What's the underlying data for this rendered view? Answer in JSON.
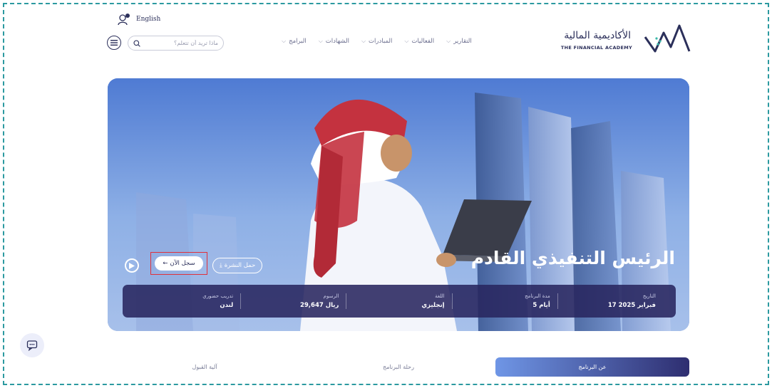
{
  "header": {
    "language_label": "English",
    "search": {
      "placeholder": "ماذا تريد أن تتعلم؟"
    },
    "nav": [
      {
        "label": "البرامج"
      },
      {
        "label": "الشهادات"
      },
      {
        "label": "المبادرات"
      },
      {
        "label": "الفعاليات"
      },
      {
        "label": "التقارير"
      }
    ],
    "logo": {
      "arabic": "الأكاديمية المالية",
      "english": "THE FINANCIAL ACADEMY"
    },
    "icons": {
      "user": "user-icon",
      "menu": "hamburger-menu-icon",
      "search": "search-icon",
      "chevron": "chevron-down-icon"
    }
  },
  "hero": {
    "title": "الرئيس التنفيذي القادم",
    "buttons": {
      "brochure": "حمل النشرة",
      "register": "سجل الآن"
    },
    "info": [
      {
        "label": "التاريخ",
        "value": "17 فبراير 2025"
      },
      {
        "label": "مدة البرنامج",
        "value": "5 أيام"
      },
      {
        "label": "اللغة",
        "value": "إنجليزي"
      },
      {
        "label": "الرسوم",
        "value": "29,647 ريال"
      },
      {
        "label": "تدريب حضوري",
        "value": "لندن"
      }
    ]
  },
  "tabs": [
    {
      "label": "عن البرنامج",
      "active": true
    },
    {
      "label": "رحلة البرنامج",
      "active": false
    },
    {
      "label": "آلية القبول",
      "active": false
    }
  ],
  "colors": {
    "primary": "#2b2f5a",
    "accent": "#6f96e6",
    "highlight": "#e0303a"
  }
}
